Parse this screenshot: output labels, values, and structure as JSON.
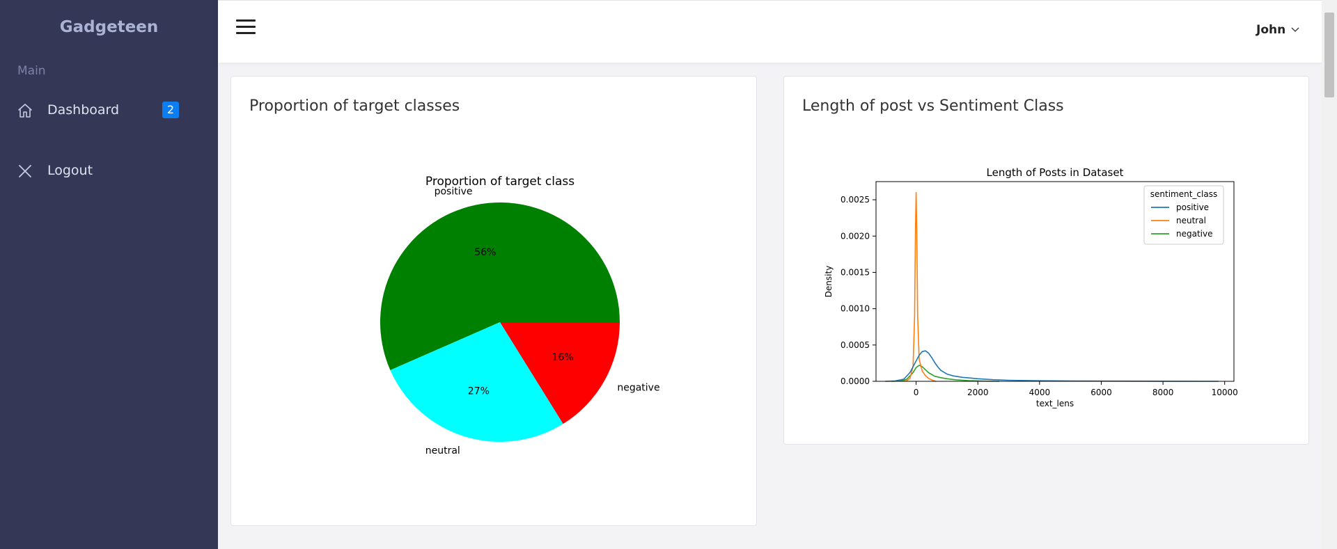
{
  "sidebar": {
    "brand": "Gadgeteen",
    "section_label": "Main",
    "items": [
      {
        "label": "Dashboard",
        "icon": "home-icon",
        "badge": "2"
      },
      {
        "label": "Logout",
        "icon": "close-icon"
      }
    ]
  },
  "topbar": {
    "menu_icon": "hamburger-icon",
    "user_name": "John",
    "user_caret_icon": "chevron-down-icon"
  },
  "cards": [
    {
      "title": "Proportion of target classes"
    },
    {
      "title": "Length of post vs Sentiment Class"
    }
  ],
  "chart_data": [
    {
      "type": "pie",
      "title": "Proportion of target class",
      "categories": [
        "positive",
        "neutral",
        "negative"
      ],
      "values": [
        56,
        27,
        16
      ],
      "value_labels": [
        "56%",
        "27%",
        "16%"
      ],
      "colors": [
        "#008000",
        "#00ffff",
        "#ff0000"
      ]
    },
    {
      "type": "line",
      "title": "Length of Posts in Dataset",
      "xlabel": "text_lens",
      "ylabel": "Density",
      "xlim": [
        -1300,
        10300
      ],
      "ylim": [
        0,
        0.00275
      ],
      "xticks": [
        0,
        2000,
        4000,
        6000,
        8000,
        10000
      ],
      "yticks": [
        "0.0000",
        "0.0005",
        "0.0010",
        "0.0015",
        "0.0020",
        "0.0025"
      ],
      "grid": false,
      "legend_title": "sentiment_class",
      "legend_position": "top-right",
      "series": [
        {
          "name": "positive",
          "color": "#1f77b4",
          "x": [
            -1000,
            -700,
            -400,
            -200,
            0,
            100,
            200,
            300,
            400,
            500,
            600,
            700,
            800,
            1000,
            1200,
            1500,
            2000,
            2500,
            3000,
            4000,
            5000,
            6000,
            8000,
            9800
          ],
          "y": [
            0,
            4e-06,
            3e-05,
            0.00012,
            0.00028,
            0.00036,
            0.00041,
            0.00042,
            0.00039,
            0.00033,
            0.00026,
            0.0002,
            0.00015,
            0.0001,
            7.5e-05,
            5.5e-05,
            3.5e-05,
            2.2e-05,
            1.4e-05,
            8e-06,
            5e-06,
            3e-06,
            1e-06,
            0
          ]
        },
        {
          "name": "neutral",
          "color": "#ff7f0e",
          "x": [
            -450,
            -300,
            -200,
            -100,
            -50,
            -20,
            0,
            20,
            50,
            100,
            200,
            300,
            400,
            500,
            600,
            650
          ],
          "y": [
            0,
            1e-05,
            4e-05,
            0.0002,
            0.0009,
            0.0021,
            0.0026,
            0.0021,
            0.0009,
            0.0003,
            0.00014,
            8e-05,
            4e-05,
            2e-05,
            5e-06,
            0
          ]
        },
        {
          "name": "negative",
          "color": "#2ca02c",
          "x": [
            -800,
            -500,
            -300,
            -100,
            0,
            100,
            200,
            300,
            400,
            600,
            800,
            1000,
            1300,
            1700,
            2200,
            2700
          ],
          "y": [
            0,
            5e-06,
            3e-05,
            0.00012,
            0.00019,
            0.00022,
            0.0002,
            0.00016,
            0.00012,
            7e-05,
            5e-05,
            3.5e-05,
            2e-05,
            1e-05,
            3e-06,
            0
          ]
        }
      ]
    }
  ]
}
